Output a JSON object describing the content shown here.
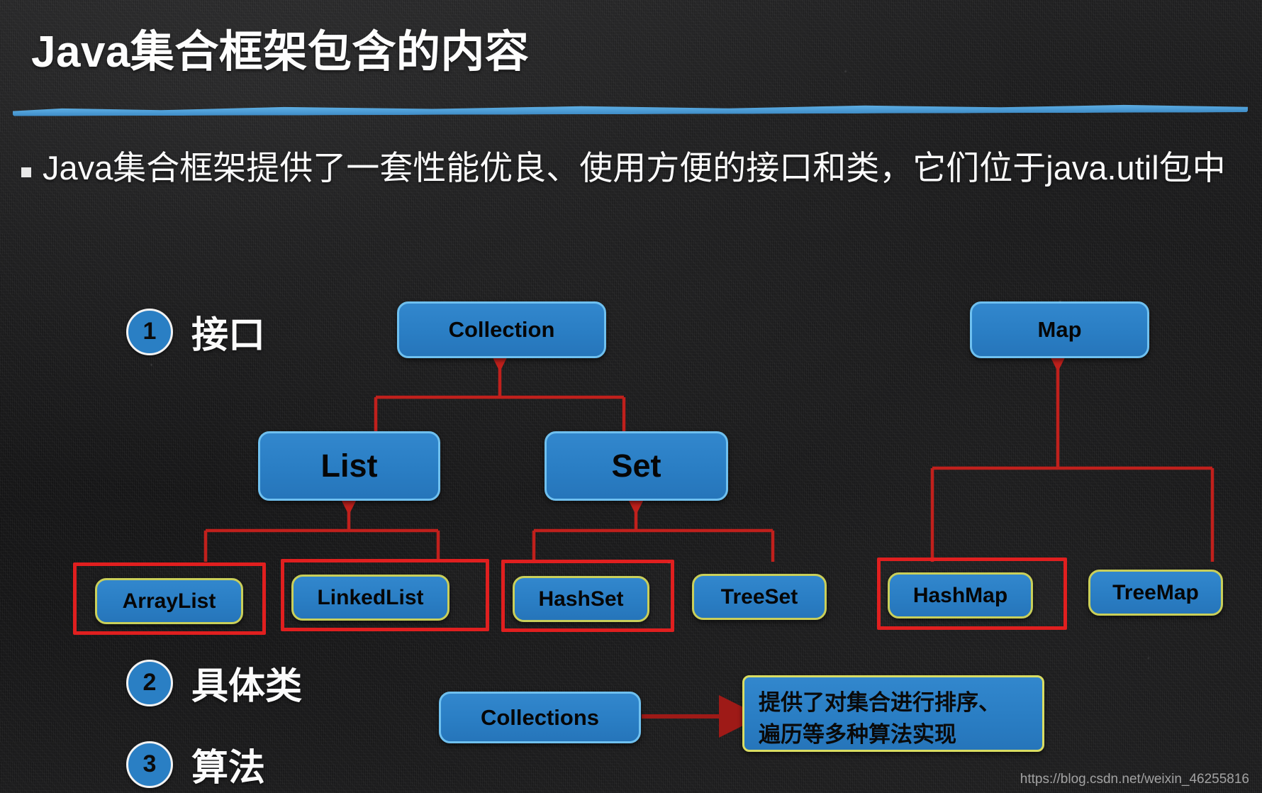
{
  "slide": {
    "title": "Java集合框架包含的内容",
    "bullet": "Java集合框架提供了一套性能优良、使用方便的接口和类，它们位于java.util包中",
    "watermark": "https://blog.csdn.net/weixin_46255816",
    "accent_color": "#2a7fc4",
    "rule_color": "#4f9fd8",
    "highlight_color": "#e01f1f",
    "concrete_border_color": "#c9cf5a",
    "interface_border_color": "#6fc0ef",
    "background_color": "#161617"
  },
  "legend": [
    {
      "number": "1",
      "label": "接口"
    },
    {
      "number": "2",
      "label": "具体类"
    },
    {
      "number": "3",
      "label": "算法"
    }
  ],
  "diagram": {
    "interfaces": [
      {
        "label": "Collection"
      },
      {
        "label": "Map"
      },
      {
        "label": "List"
      },
      {
        "label": "Set"
      }
    ],
    "classes": [
      {
        "label": "ArrayList",
        "highlighted": "true"
      },
      {
        "label": "LinkedList",
        "highlighted": "true"
      },
      {
        "label": "HashSet",
        "highlighted": "true"
      },
      {
        "label": "TreeSet",
        "highlighted": "false"
      },
      {
        "label": "HashMap",
        "highlighted": "true"
      },
      {
        "label": "TreeMap",
        "highlighted": "false"
      }
    ],
    "algorithms": {
      "label": "Collections"
    },
    "note": {
      "line1": "提供了对集合进行排序、",
      "line2": "遍历等多种算法实现"
    }
  }
}
